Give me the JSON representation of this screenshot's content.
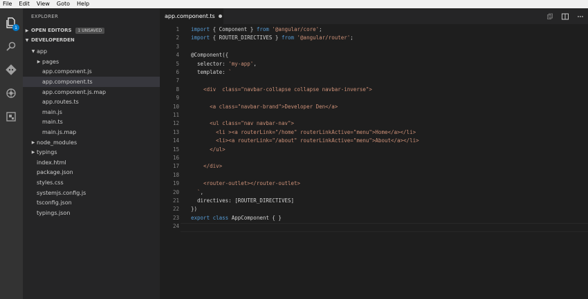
{
  "menu": [
    "File",
    "Edit",
    "View",
    "Goto",
    "Help"
  ],
  "activity_bar": {
    "icons": [
      "files-icon",
      "search-icon",
      "git-icon",
      "debug-icon",
      "extensions-icon"
    ],
    "badge": "1"
  },
  "sidebar": {
    "title": "EXPLORER",
    "open_editors": {
      "label": "OPEN EDITORS",
      "badge": "1 UNSAVED"
    },
    "project": {
      "label": "DEVELOPERDEN"
    },
    "tree": [
      {
        "label": "app",
        "indent": 1,
        "caret": "▼"
      },
      {
        "label": "pages",
        "indent": 2,
        "caret": "▶"
      },
      {
        "label": "app.component.js",
        "indent": 2,
        "caret": ""
      },
      {
        "label": "app.component.ts",
        "indent": 2,
        "caret": "",
        "selected": true
      },
      {
        "label": "app.component.js.map",
        "indent": 2,
        "caret": ""
      },
      {
        "label": "app.routes.ts",
        "indent": 2,
        "caret": ""
      },
      {
        "label": "main.js",
        "indent": 2,
        "caret": ""
      },
      {
        "label": "main.ts",
        "indent": 2,
        "caret": ""
      },
      {
        "label": "main.js.map",
        "indent": 2,
        "caret": ""
      },
      {
        "label": "node_modules",
        "indent": 1,
        "caret": "▶"
      },
      {
        "label": "typings",
        "indent": 1,
        "caret": "▶"
      },
      {
        "label": "index.html",
        "indent": 1,
        "caret": ""
      },
      {
        "label": "package.json",
        "indent": 1,
        "caret": ""
      },
      {
        "label": "styles.css",
        "indent": 1,
        "caret": ""
      },
      {
        "label": "systemjs.config.js",
        "indent": 1,
        "caret": ""
      },
      {
        "label": "tsconfig.json",
        "indent": 1,
        "caret": ""
      },
      {
        "label": "typings.json",
        "indent": 1,
        "caret": ""
      }
    ]
  },
  "editor": {
    "tab_label": "app.component.ts",
    "lines": [
      [
        [
          "kw",
          "import"
        ],
        [
          "plain",
          " { Component } "
        ],
        [
          "kw",
          "from"
        ],
        [
          "plain",
          " "
        ],
        [
          "str",
          "'@angular/core'"
        ],
        [
          "plain",
          ";"
        ]
      ],
      [
        [
          "kw",
          "import"
        ],
        [
          "plain",
          " { ROUTER_DIRECTIVES } "
        ],
        [
          "kw",
          "from"
        ],
        [
          "plain",
          " "
        ],
        [
          "str",
          "'@angular/router'"
        ],
        [
          "plain",
          ";"
        ]
      ],
      [],
      [
        [
          "plain",
          "@Component({"
        ]
      ],
      [
        [
          "plain",
          "  selector: "
        ],
        [
          "str",
          "'my-app'"
        ],
        [
          "plain",
          ","
        ]
      ],
      [
        [
          "plain",
          "  template: "
        ],
        [
          "str",
          "`"
        ]
      ],
      [],
      [
        [
          "tag",
          "    <div  class=\"navbar-collapse collapse navbar-inverse\">"
        ]
      ],
      [],
      [
        [
          "tag",
          "      <a class=\"navbar-brand\">Developer Den</a>"
        ]
      ],
      [],
      [
        [
          "tag",
          "      <ul class=\"nav navbar-nav\">"
        ]
      ],
      [
        [
          "tag",
          "        <li ><a routerLink=\"/home\" routerLinkActive=\"menu\">Home</a></li>"
        ]
      ],
      [
        [
          "tag",
          "        <li><a routerLink=\"/about\" routerLinkActive=\"menu\">About</a></li>"
        ]
      ],
      [
        [
          "tag",
          "      </ul>"
        ]
      ],
      [],
      [
        [
          "tag",
          "    </div>"
        ]
      ],
      [],
      [
        [
          "tag",
          "    <router-outlet></router-outlet>"
        ]
      ],
      [
        [
          "str",
          "  `"
        ],
        [
          "plain",
          ","
        ]
      ],
      [
        [
          "plain",
          "  directives: [ROUTER_DIRECTIVES]"
        ]
      ],
      [
        [
          "plain",
          "})"
        ]
      ],
      [
        [
          "kw",
          "export"
        ],
        [
          "plain",
          " "
        ],
        [
          "kw",
          "class"
        ],
        [
          "plain",
          " AppComponent { }"
        ]
      ],
      []
    ]
  },
  "colors": {
    "keyword": "#569cd6",
    "string": "#ce9178",
    "accent": "#007acc"
  }
}
